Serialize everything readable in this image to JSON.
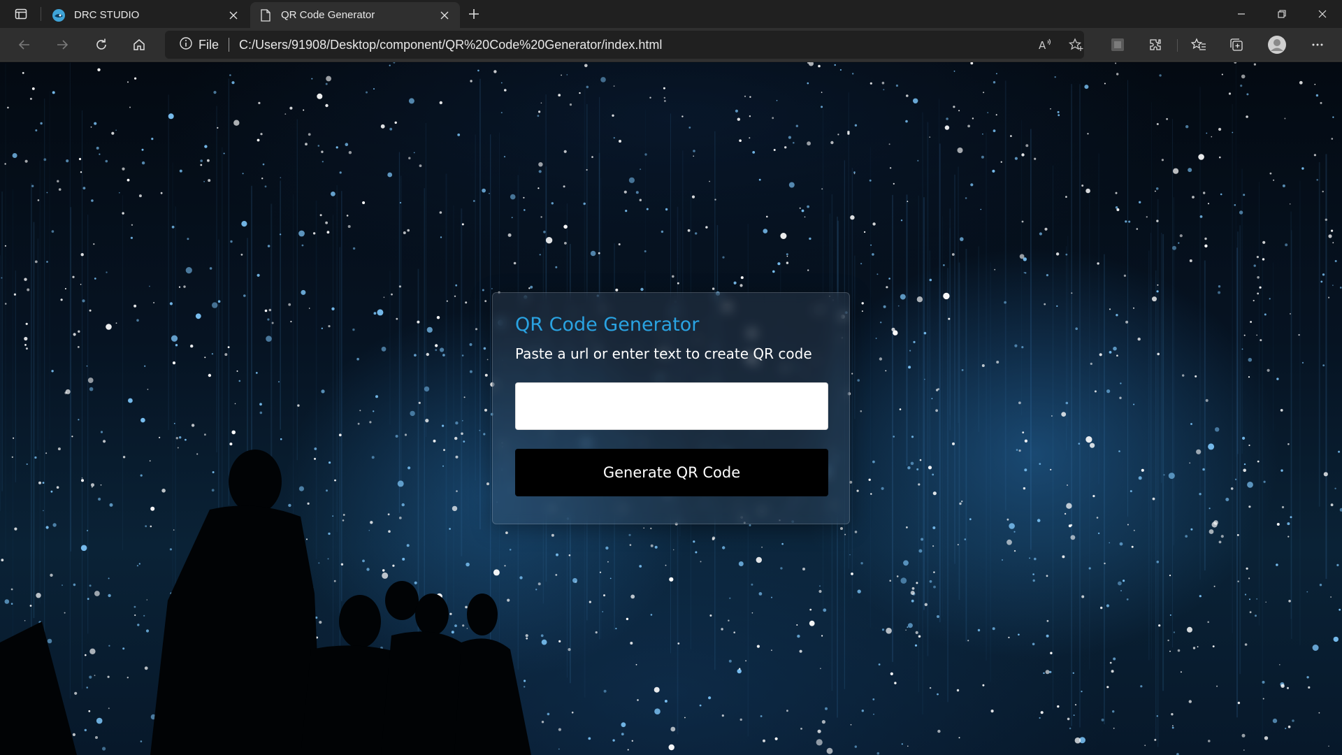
{
  "browser": {
    "tabs": [
      {
        "title": "DRC STUDIO",
        "active": false,
        "icon": "drc-studio-favicon"
      },
      {
        "title": "QR Code Generator",
        "active": true,
        "icon": "page-icon"
      }
    ],
    "address": {
      "scheme_label": "File",
      "url": "C:/Users/91908/Desktop/component/QR%20Code%20Generator/index.html"
    }
  },
  "page": {
    "background": "night-light-installation-photo",
    "card": {
      "title": "QR Code Generator",
      "subtitle": "Paste a url or enter text to create QR code",
      "input_value": "",
      "button_label": "Generate QR Code"
    }
  },
  "colors": {
    "title_accent": "#2aa3e2",
    "button_bg": "#000000",
    "chrome_bg": "#202020",
    "toolbar_bg": "#2f2f2f"
  }
}
